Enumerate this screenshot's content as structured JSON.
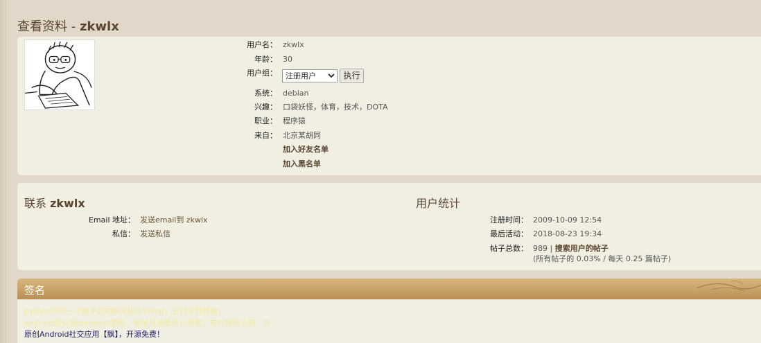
{
  "page": {
    "title_prefix": "查看资料 - ",
    "username": "zkwlx"
  },
  "profile": {
    "fields": [
      {
        "label": "用户名：",
        "value": "zkwlx"
      },
      {
        "label": "年龄：",
        "value": "30"
      },
      {
        "label": "用户组：",
        "value": ""
      },
      {
        "label": "系统：",
        "value": "debian"
      },
      {
        "label": "兴趣：",
        "value": "口袋妖怪，体育，技术，DOTA"
      },
      {
        "label": "职业：",
        "value": "程序猿"
      },
      {
        "label": "来自：",
        "value": "北京某胡同"
      }
    ],
    "group_select": {
      "selected": "注册用户"
    },
    "exec_button": "执行",
    "add_friend": "加入好友名单",
    "add_block": "加入黑名单"
  },
  "contact": {
    "title_prefix": "联系 ",
    "title_user": "zkwlx",
    "email_label": "Email 地址：",
    "email_value": "发送email到 zkwlx",
    "pm_label": "私信：",
    "pm_value": "发送私信"
  },
  "stats": {
    "title": "用户统计",
    "reg_label": "注册时间：",
    "reg_value": "2009-10-09 12:54",
    "last_label": "最后活动：",
    "last_value": "2018-08-23 19:34",
    "posts_label": "帖子总数：",
    "posts_count": "989",
    "posts_sep": " | ",
    "posts_search": "搜索用户的帖子",
    "posts_detail": "(所有帖子的 0.03% / 每天 0.25 篇帖子)"
  },
  "signature": {
    "title": "签名",
    "line1": "python写的一个跨平台的聊天软件TChat，支持文件传输。",
    "line2": "android防火墙droidwall更新，添加月流量统计功能，有兴趣的点我：D",
    "line3": "原创Android社交应用【飘】，开源免费！"
  },
  "colors": {
    "background": "#e1d8c9",
    "panel": "#f1eee2",
    "heading": "#5a4530",
    "sig_header": "#c7a066"
  }
}
